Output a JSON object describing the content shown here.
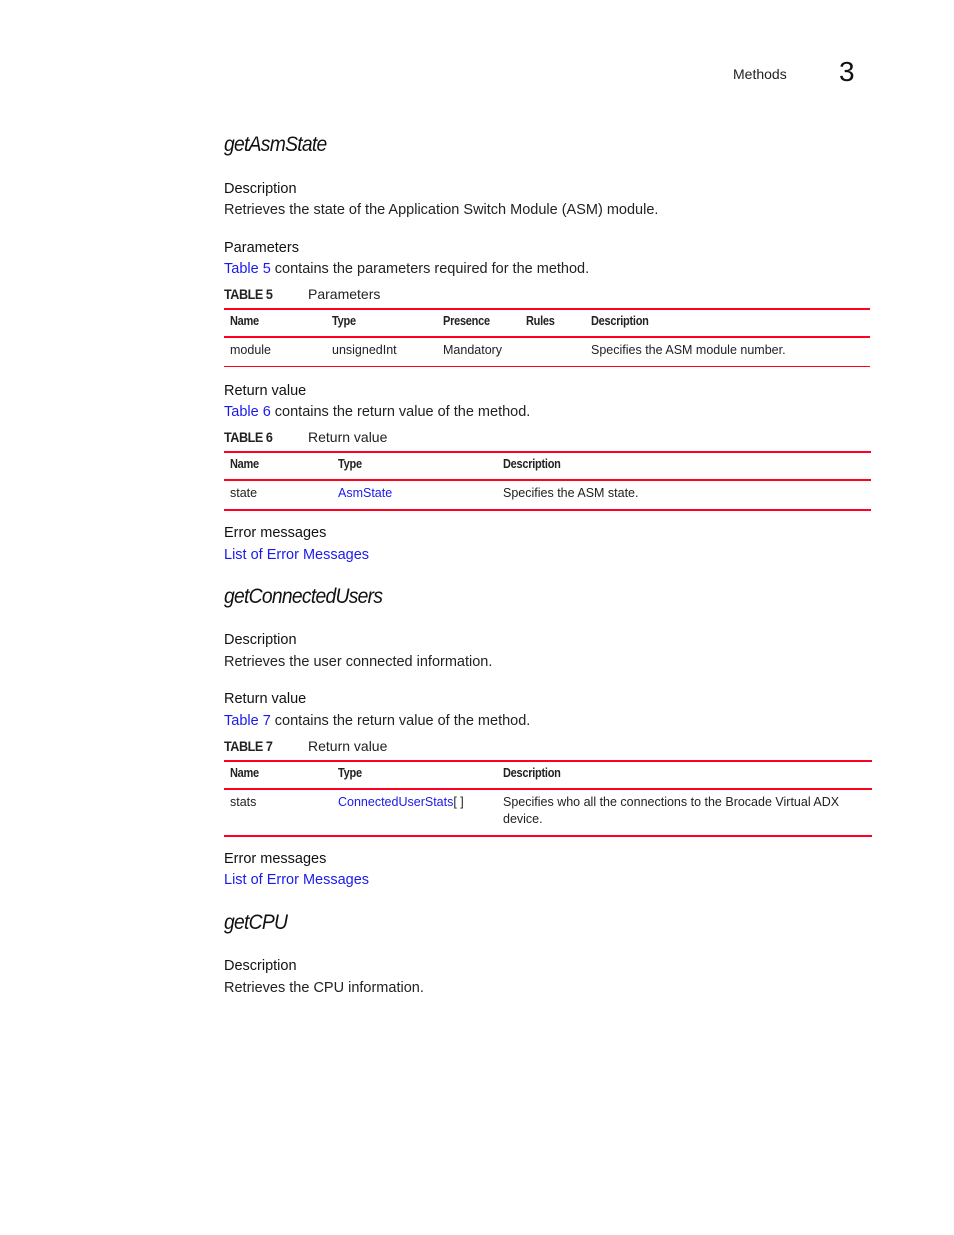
{
  "header": {
    "section_title": "Methods",
    "chapter_number": "3"
  },
  "colors": {
    "accent_red": "#ff0022",
    "link_blue": "#1a1aee"
  },
  "methods": [
    {
      "name": "getAsmState",
      "description_heading": "Description",
      "description": "Retrieves the state of the Application Switch Module (ASM) module.",
      "parameters": {
        "heading": "Parameters",
        "intro_link": "Table 5",
        "intro_text": " contains the parameters required for the method.",
        "table": {
          "number": "TABLE 5",
          "caption": "Parameters",
          "columns": [
            "Name",
            "Type",
            "Presence",
            "Rules",
            "Description"
          ],
          "rows": [
            [
              "module",
              "unsignedInt",
              "Mandatory",
              "",
              "Specifies the ASM module number."
            ]
          ]
        }
      },
      "return_value": {
        "heading": "Return value",
        "intro_link": "Table 6",
        "intro_text": " contains the return value of the method.",
        "table": {
          "number": "TABLE 6",
          "caption": "Return value",
          "columns": [
            "Name",
            "Type",
            "Description"
          ],
          "rows": [
            [
              "state",
              "AsmState",
              "Specifies the ASM state."
            ]
          ]
        }
      },
      "errors": {
        "heading": "Error messages",
        "link": "List of Error Messages"
      }
    },
    {
      "name": "getConnectedUsers",
      "description_heading": "Description",
      "description": "Retrieves the user connected information.",
      "return_value": {
        "heading": "Return value",
        "intro_link": "Table 7",
        "intro_text": " contains the return value of the method.",
        "table": {
          "number": "TABLE 7",
          "caption": "Return value",
          "columns": [
            "Name",
            "Type",
            "Description"
          ],
          "rows": [
            [
              "stats",
              "ConnectedUserStats",
              "[ ]",
              "Specifies who all the connections to the Brocade Virtual ADX device."
            ]
          ]
        }
      },
      "errors": {
        "heading": "Error messages",
        "link": "List of Error Messages"
      }
    },
    {
      "name": "getCPU",
      "description_heading": "Description",
      "description": "Retrieves the CPU information."
    }
  ]
}
